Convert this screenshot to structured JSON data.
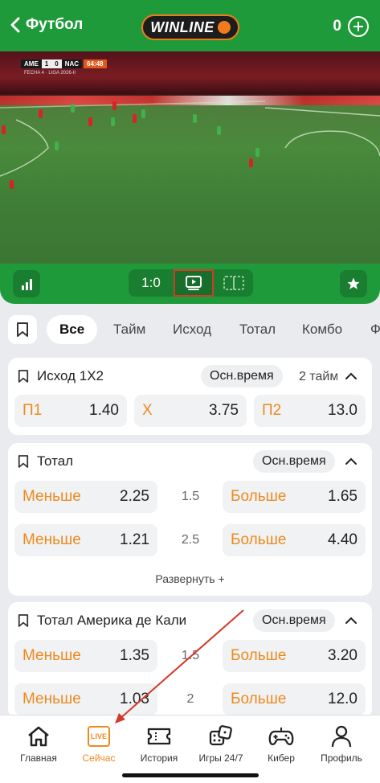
{
  "header": {
    "back_label": "Футбол",
    "logo_text": "WINLINE",
    "balance": "0"
  },
  "video": {
    "home_team": "AME",
    "score_home": "1",
    "score_away": "0",
    "away_team": "NAC",
    "clock": "64:48",
    "league": "FECHA 4 · LIGA 2026-II"
  },
  "controls": {
    "score": "1:0"
  },
  "tabs": [
    "Все",
    "Тайм",
    "Исход",
    "Тотал",
    "Комбо",
    "Ф"
  ],
  "card1": {
    "title": "Исход 1X2",
    "period": "Осн.время",
    "period2": "2 тайм",
    "odds": [
      {
        "label": "П1",
        "value": "1.40"
      },
      {
        "label": "X",
        "value": "3.75"
      },
      {
        "label": "П2",
        "value": "13.0"
      }
    ]
  },
  "card2": {
    "title": "Тотал",
    "period": "Осн.время",
    "rows": [
      {
        "under_label": "Меньше",
        "under": "2.25",
        "line": "1.5",
        "over_label": "Больше",
        "over": "1.65"
      },
      {
        "under_label": "Меньше",
        "under": "1.21",
        "line": "2.5",
        "over_label": "Больше",
        "over": "4.40"
      }
    ],
    "expand": "Развернуть +"
  },
  "card3": {
    "title": "Тотал Америка де Кали",
    "period": "Осн.время",
    "rows": [
      {
        "under_label": "Меньше",
        "under": "1.35",
        "line": "1.5",
        "over_label": "Больше",
        "over": "3.20"
      },
      {
        "under_label": "Меньше",
        "under": "1.03",
        "line": "2",
        "over_label": "Больше",
        "over": "12.0"
      }
    ]
  },
  "nav": [
    {
      "label": "Главная",
      "icon": "home-icon"
    },
    {
      "label": "Сейчас",
      "icon": "live-icon",
      "badge": "LIVE"
    },
    {
      "label": "История",
      "icon": "ticket-icon"
    },
    {
      "label": "Игры 24/7",
      "icon": "dice-icon"
    },
    {
      "label": "Кибер",
      "icon": "gamepad-icon"
    },
    {
      "label": "Профиль",
      "icon": "user-icon"
    }
  ],
  "colors": {
    "brand_green": "#1f9a3a",
    "accent_orange": "#ec8a1d",
    "annotation_red": "#d23a2a"
  }
}
